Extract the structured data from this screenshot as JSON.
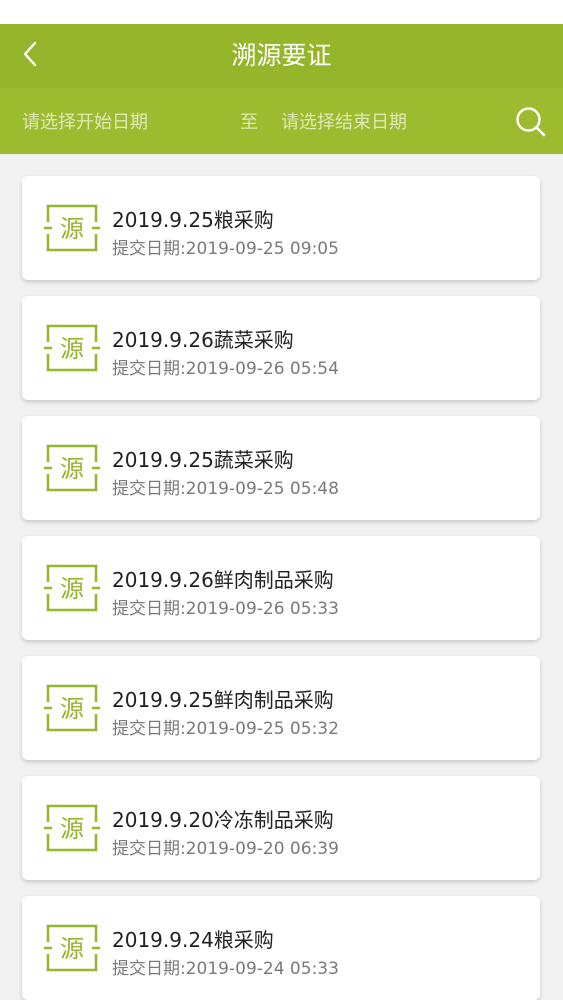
{
  "header": {
    "title": "溯源要证",
    "back_icon": "chevron-left-icon"
  },
  "filter": {
    "start_placeholder": "请选择开始日期",
    "separator": "至",
    "end_placeholder": "请选择结束日期",
    "search_icon": "search-icon"
  },
  "colors": {
    "primary": "#95b52a",
    "filter_bg": "#9dbb2f",
    "page_bg": "#f2f2f2"
  },
  "list": {
    "badge_text": "源",
    "date_label": "提交日期:",
    "items": [
      {
        "title": "2019.9.25粮采购",
        "date": "2019-09-25 09:05"
      },
      {
        "title": "2019.9.26蔬菜采购",
        "date": "2019-09-26 05:54"
      },
      {
        "title": "2019.9.25蔬菜采购",
        "date": "2019-09-25 05:48"
      },
      {
        "title": "2019.9.26鲜肉制品采购",
        "date": "2019-09-26 05:33"
      },
      {
        "title": "2019.9.25鲜肉制品采购",
        "date": "2019-09-25 05:32"
      },
      {
        "title": "2019.9.20冷冻制品采购",
        "date": "2019-09-20 06:39"
      },
      {
        "title": "2019.9.24粮采购",
        "date": "2019-09-24 05:33"
      }
    ]
  }
}
